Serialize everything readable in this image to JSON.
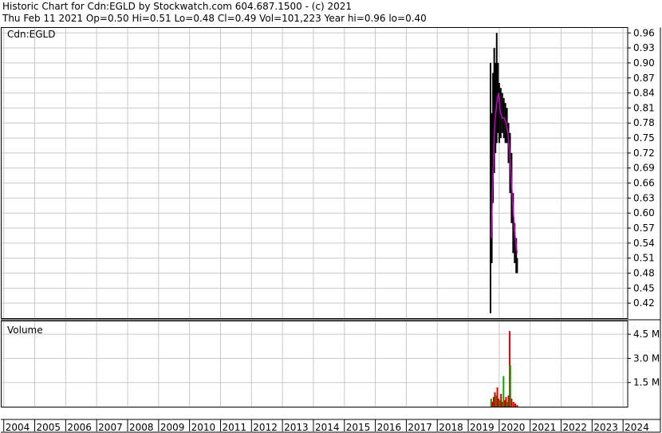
{
  "header": {
    "line1": "Historic Chart for Cdn:EGLD by Stockwatch.com 604.687.1500 - (c) 2021",
    "line2": "Thu Feb 11 2021  Op=0.50  Hi=0.51  Lo=0.48  Cl=0.49  Vol=101,223  Year hi=0.96  lo=0.40"
  },
  "colors": {
    "grid": "#c8c8c8",
    "price": "#000000",
    "moving_average": "#cc00cc",
    "volume_up": "#00aa00",
    "volume_down": "#dd0000"
  },
  "chart_data": [
    {
      "type": "line",
      "panel": "price",
      "label": "Cdn:EGLD",
      "y_ticks": [
        "0.96",
        "0.93",
        "0.90",
        "0.87",
        "0.84",
        "0.81",
        "0.78",
        "0.75",
        "0.72",
        "0.69",
        "0.66",
        "0.63",
        "0.60",
        "0.57",
        "0.54",
        "0.51",
        "0.48",
        "0.45",
        "0.42"
      ],
      "ylim": [
        0.39,
        0.97
      ],
      "grid": true,
      "series": [
        {
          "values": [
            {
              "x": 2019.72,
              "low": 0.4,
              "high": 0.9
            },
            {
              "x": 2019.76,
              "low": 0.5,
              "high": 0.8
            },
            {
              "x": 2019.8,
              "low": 0.62,
              "high": 0.88
            },
            {
              "x": 2019.84,
              "low": 0.68,
              "high": 0.93
            },
            {
              "x": 2019.88,
              "low": 0.72,
              "high": 0.9
            },
            {
              "x": 2019.92,
              "low": 0.74,
              "high": 0.96
            },
            {
              "x": 2019.96,
              "low": 0.76,
              "high": 0.9
            },
            {
              "x": 2020.0,
              "low": 0.74,
              "high": 0.86
            },
            {
              "x": 2020.05,
              "low": 0.75,
              "high": 0.85
            },
            {
              "x": 2020.1,
              "low": 0.76,
              "high": 0.84
            },
            {
              "x": 2020.15,
              "low": 0.75,
              "high": 0.83
            },
            {
              "x": 2020.2,
              "low": 0.74,
              "high": 0.82
            },
            {
              "x": 2020.25,
              "low": 0.74,
              "high": 0.81
            },
            {
              "x": 2020.3,
              "low": 0.7,
              "high": 0.78
            },
            {
              "x": 2020.35,
              "low": 0.64,
              "high": 0.76
            },
            {
              "x": 2020.4,
              "low": 0.58,
              "high": 0.72
            },
            {
              "x": 2020.45,
              "low": 0.52,
              "high": 0.64
            },
            {
              "x": 2020.5,
              "low": 0.5,
              "high": 0.58
            },
            {
              "x": 2020.55,
              "low": 0.48,
              "high": 0.55
            },
            {
              "x": 2020.58,
              "low": 0.48,
              "high": 0.51
            }
          ]
        },
        {
          "values": [
            {
              "x": 2019.74,
              "y": 0.55
            },
            {
              "x": 2019.8,
              "y": 0.68
            },
            {
              "x": 2019.86,
              "y": 0.78
            },
            {
              "x": 2019.92,
              "y": 0.82
            },
            {
              "x": 2019.98,
              "y": 0.84
            },
            {
              "x": 2020.04,
              "y": 0.8
            },
            {
              "x": 2020.1,
              "y": 0.79
            },
            {
              "x": 2020.16,
              "y": 0.79
            },
            {
              "x": 2020.22,
              "y": 0.78
            },
            {
              "x": 2020.28,
              "y": 0.76
            },
            {
              "x": 2020.34,
              "y": 0.72
            },
            {
              "x": 2020.4,
              "y": 0.66
            },
            {
              "x": 2020.46,
              "y": 0.6
            },
            {
              "x": 2020.52,
              "y": 0.55
            },
            {
              "x": 2020.58,
              "y": 0.52
            }
          ]
        }
      ]
    },
    {
      "type": "bar",
      "panel": "volume",
      "label": "Volume",
      "y_ticks": [
        "4.5 M",
        "3.0 M",
        "1.5 M"
      ],
      "ylim": [
        0,
        5.3
      ],
      "grid": true,
      "series": [
        {
          "values": [
            {
              "x": 2019.74,
              "y": 0.5,
              "up": true
            },
            {
              "x": 2019.78,
              "y": 0.3,
              "up": false
            },
            {
              "x": 2019.82,
              "y": 0.6,
              "up": false
            },
            {
              "x": 2019.86,
              "y": 0.9,
              "up": false
            },
            {
              "x": 2019.9,
              "y": 0.7,
              "up": true
            },
            {
              "x": 2019.94,
              "y": 1.2,
              "up": false
            },
            {
              "x": 2019.98,
              "y": 0.5,
              "up": false
            },
            {
              "x": 2020.02,
              "y": 0.4,
              "up": true
            },
            {
              "x": 2020.06,
              "y": 0.8,
              "up": false
            },
            {
              "x": 2020.1,
              "y": 0.3,
              "up": false
            },
            {
              "x": 2020.14,
              "y": 1.9,
              "up": true
            },
            {
              "x": 2020.18,
              "y": 0.4,
              "up": false
            },
            {
              "x": 2020.22,
              "y": 0.6,
              "up": false
            },
            {
              "x": 2020.26,
              "y": 0.3,
              "up": true
            },
            {
              "x": 2020.3,
              "y": 0.7,
              "up": false
            },
            {
              "x": 2020.34,
              "y": 4.7,
              "up": false
            },
            {
              "x": 2020.36,
              "y": 2.6,
              "up": true
            },
            {
              "x": 2020.4,
              "y": 0.5,
              "up": false
            },
            {
              "x": 2020.46,
              "y": 0.3,
              "up": false
            },
            {
              "x": 2020.52,
              "y": 0.2,
              "up": false
            },
            {
              "x": 2020.58,
              "y": 0.1,
              "up": false
            }
          ]
        }
      ]
    },
    {
      "type": "axis",
      "panel": "x-axis",
      "categories": [
        "2004",
        "2005",
        "2006",
        "2007",
        "2008",
        "2009",
        "2010",
        "2011",
        "2012",
        "2013",
        "2014",
        "2015",
        "2016",
        "2017",
        "2018",
        "2019",
        "2020",
        "2021",
        "2022",
        "2023",
        "2024"
      ],
      "xlim": [
        2003.93,
        2024.15
      ]
    }
  ]
}
